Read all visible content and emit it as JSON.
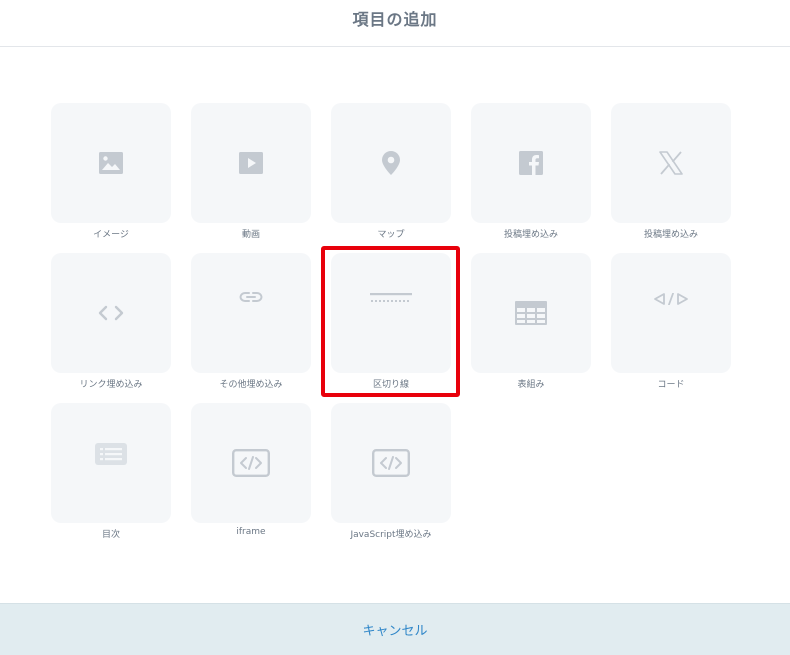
{
  "dialog": {
    "title": "項目の追加"
  },
  "items": [
    {
      "label": "イメージ",
      "icon": "image-icon"
    },
    {
      "label": "動画",
      "icon": "play-icon"
    },
    {
      "label": "マップ",
      "icon": "map-pin-icon"
    },
    {
      "label": "投稿埋め込み",
      "icon": "facebook-icon"
    },
    {
      "label": "投稿埋め込み",
      "icon": "x-logo-icon"
    },
    {
      "label": "リンク埋め込み",
      "icon": "code-brackets-icon"
    },
    {
      "label": "その他埋め込み",
      "icon": "link-icon"
    },
    {
      "label": "区切り線",
      "icon": "divider-icon",
      "selected": true
    },
    {
      "label": "表組み",
      "icon": "table-icon"
    },
    {
      "label": "コード",
      "icon": "code-icon"
    },
    {
      "label": "目次",
      "icon": "list-icon"
    },
    {
      "label": "iframe",
      "icon": "iframe-code-icon"
    },
    {
      "label": "JavaScript埋め込み",
      "icon": "javascript-code-icon"
    }
  ],
  "footer": {
    "cancel_label": "キャンセル"
  },
  "colors": {
    "highlight": "#e8000b",
    "tile_background": "#f5f7f9",
    "icon": "#c4cad1",
    "cancel_text": "#2f86c8",
    "footer_background": "#e1ecf0"
  }
}
